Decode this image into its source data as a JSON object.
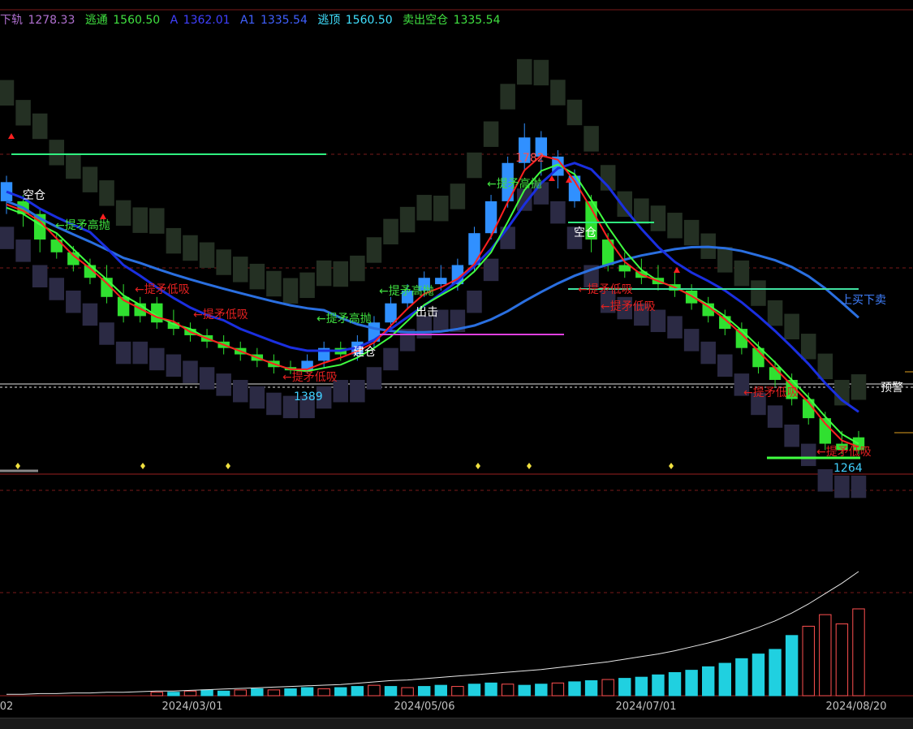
{
  "legend": {
    "lower_band_label": "下轨",
    "lower_band_value": "1278.33",
    "escape_label": "逃通",
    "escape_value": "1560.50",
    "a_label": "A",
    "a_value": "1362.01",
    "a1_label": "A1",
    "a1_value": "1335.54",
    "top_label": "逃顶",
    "top_value": "1560.50",
    "sell_label": "卖出空仓",
    "sell_value": "1335.54"
  },
  "colors": {
    "lower_band": "#b070d0",
    "escape": "#40e040",
    "a": "#4040ff",
    "a1": "#4060ff",
    "top": "#40e0ff",
    "sell": "#40e040",
    "up_bar": "#30e030",
    "down_bar": "#3090ff",
    "cloud_top": "#243023",
    "cloud_bottom": "#2b2a44",
    "ma_blue": "#2a6fe0",
    "ma_navy": "#1a2fe0",
    "ma_green": "#40ff40",
    "ma_red": "#ff2020",
    "grid": "#7a1a1a",
    "vol_cyan": "#20d0e0",
    "vol_red": "#ff5050"
  },
  "annotations": {
    "high_value": "1782",
    "low_value_1": "1389",
    "low_value_2": "1264",
    "warn_label": "预警",
    "buy_sell_label": "上买下卖",
    "short_label": "空仓",
    "build_label": "建仓",
    "out_label": "出击",
    "top_throw": "←提矛高抛",
    "low_absorb": "←提矛低吸"
  },
  "x_axis": {
    "labels": [
      "02",
      "2024/03/01",
      "2024/05/06",
      "2024/07/01",
      "2024/08/20"
    ]
  },
  "chart_data": {
    "type": "bar",
    "panes": [
      "price",
      "volume"
    ],
    "price_ylim": [
      1240,
      1950
    ],
    "dates_note_only_axis": [
      "2024/03/01",
      "2024/05/06",
      "2024/07/01",
      "2024/08/20"
    ],
    "price_bars": [
      {
        "o": 1690,
        "c": 1660,
        "h": 1700,
        "l": 1640,
        "u": 0
      },
      {
        "o": 1660,
        "c": 1640,
        "h": 1670,
        "l": 1620,
        "u": 1
      },
      {
        "o": 1640,
        "c": 1600,
        "h": 1650,
        "l": 1580,
        "u": 1
      },
      {
        "o": 1600,
        "c": 1580,
        "h": 1610,
        "l": 1570,
        "u": 1
      },
      {
        "o": 1580,
        "c": 1560,
        "h": 1590,
        "l": 1550,
        "u": 1
      },
      {
        "o": 1560,
        "c": 1540,
        "h": 1570,
        "l": 1530,
        "u": 1
      },
      {
        "o": 1540,
        "c": 1510,
        "h": 1560,
        "l": 1500,
        "u": 1
      },
      {
        "o": 1510,
        "c": 1480,
        "h": 1530,
        "l": 1470,
        "u": 1
      },
      {
        "o": 1480,
        "c": 1500,
        "h": 1510,
        "l": 1470,
        "u": 1
      },
      {
        "o": 1500,
        "c": 1470,
        "h": 1510,
        "l": 1460,
        "u": 1
      },
      {
        "o": 1470,
        "c": 1460,
        "h": 1490,
        "l": 1450,
        "u": 1
      },
      {
        "o": 1460,
        "c": 1450,
        "h": 1470,
        "l": 1440,
        "u": 1
      },
      {
        "o": 1450,
        "c": 1440,
        "h": 1460,
        "l": 1430,
        "u": 1
      },
      {
        "o": 1440,
        "c": 1430,
        "h": 1450,
        "l": 1420,
        "u": 1
      },
      {
        "o": 1430,
        "c": 1420,
        "h": 1440,
        "l": 1410,
        "u": 1
      },
      {
        "o": 1420,
        "c": 1410,
        "h": 1430,
        "l": 1400,
        "u": 1
      },
      {
        "o": 1410,
        "c": 1400,
        "h": 1420,
        "l": 1390,
        "u": 1
      },
      {
        "o": 1400,
        "c": 1395,
        "h": 1410,
        "l": 1389,
        "u": 1
      },
      {
        "o": 1395,
        "c": 1410,
        "h": 1420,
        "l": 1390,
        "u": 0
      },
      {
        "o": 1410,
        "c": 1430,
        "h": 1440,
        "l": 1400,
        "u": 0
      },
      {
        "o": 1430,
        "c": 1420,
        "h": 1440,
        "l": 1410,
        "u": 1
      },
      {
        "o": 1420,
        "c": 1440,
        "h": 1450,
        "l": 1410,
        "u": 0
      },
      {
        "o": 1440,
        "c": 1470,
        "h": 1480,
        "l": 1430,
        "u": 0
      },
      {
        "o": 1470,
        "c": 1500,
        "h": 1510,
        "l": 1460,
        "u": 0
      },
      {
        "o": 1500,
        "c": 1520,
        "h": 1530,
        "l": 1490,
        "u": 0
      },
      {
        "o": 1520,
        "c": 1540,
        "h": 1550,
        "l": 1510,
        "u": 0
      },
      {
        "o": 1540,
        "c": 1530,
        "h": 1560,
        "l": 1520,
        "u": 0
      },
      {
        "o": 1530,
        "c": 1560,
        "h": 1570,
        "l": 1520,
        "u": 0
      },
      {
        "o": 1560,
        "c": 1610,
        "h": 1620,
        "l": 1550,
        "u": 0
      },
      {
        "o": 1610,
        "c": 1660,
        "h": 1670,
        "l": 1600,
        "u": 0
      },
      {
        "o": 1660,
        "c": 1720,
        "h": 1730,
        "l": 1650,
        "u": 0
      },
      {
        "o": 1720,
        "c": 1760,
        "h": 1782,
        "l": 1710,
        "u": 0
      },
      {
        "o": 1760,
        "c": 1730,
        "h": 1770,
        "l": 1700,
        "u": 0
      },
      {
        "o": 1730,
        "c": 1700,
        "h": 1740,
        "l": 1680,
        "u": 0
      },
      {
        "o": 1700,
        "c": 1660,
        "h": 1710,
        "l": 1650,
        "u": 0
      },
      {
        "o": 1660,
        "c": 1600,
        "h": 1670,
        "l": 1580,
        "u": 1
      },
      {
        "o": 1600,
        "c": 1560,
        "h": 1610,
        "l": 1550,
        "u": 1
      },
      {
        "o": 1560,
        "c": 1550,
        "h": 1580,
        "l": 1540,
        "u": 1
      },
      {
        "o": 1550,
        "c": 1540,
        "h": 1570,
        "l": 1530,
        "u": 1
      },
      {
        "o": 1540,
        "c": 1530,
        "h": 1560,
        "l": 1520,
        "u": 1
      },
      {
        "o": 1530,
        "c": 1520,
        "h": 1550,
        "l": 1510,
        "u": 1
      },
      {
        "o": 1520,
        "c": 1500,
        "h": 1530,
        "l": 1490,
        "u": 1
      },
      {
        "o": 1500,
        "c": 1480,
        "h": 1510,
        "l": 1470,
        "u": 1
      },
      {
        "o": 1480,
        "c": 1460,
        "h": 1490,
        "l": 1450,
        "u": 1
      },
      {
        "o": 1460,
        "c": 1430,
        "h": 1470,
        "l": 1420,
        "u": 1
      },
      {
        "o": 1430,
        "c": 1400,
        "h": 1440,
        "l": 1390,
        "u": 1
      },
      {
        "o": 1400,
        "c": 1380,
        "h": 1410,
        "l": 1370,
        "u": 1
      },
      {
        "o": 1380,
        "c": 1350,
        "h": 1390,
        "l": 1340,
        "u": 1
      },
      {
        "o": 1350,
        "c": 1320,
        "h": 1360,
        "l": 1310,
        "u": 1
      },
      {
        "o": 1320,
        "c": 1280,
        "h": 1330,
        "l": 1270,
        "u": 1
      },
      {
        "o": 1280,
        "c": 1270,
        "h": 1300,
        "l": 1264,
        "u": 1
      },
      {
        "o": 1270,
        "c": 1290,
        "h": 1300,
        "l": 1264,
        "u": 1
      }
    ],
    "volume": [
      2,
      2,
      2,
      3,
      3,
      3,
      4,
      4,
      4,
      3,
      3,
      4,
      5,
      4,
      5,
      6,
      5,
      6,
      7,
      6,
      7,
      8,
      9,
      8,
      7,
      8,
      9,
      8,
      10,
      11,
      10,
      9,
      10,
      11,
      12,
      13,
      14,
      15,
      16,
      18,
      20,
      22,
      25,
      28,
      32,
      36,
      40,
      52,
      60,
      70,
      62,
      75
    ],
    "volume_colors": [
      "c",
      "r",
      "c",
      "c",
      "r",
      "c",
      "r",
      "c",
      "c",
      "r",
      "c",
      "r",
      "c",
      "c",
      "r",
      "c",
      "r",
      "c",
      "c",
      "r",
      "c",
      "c",
      "r",
      "c",
      "r",
      "c",
      "c",
      "r",
      "c",
      "c",
      "r",
      "c",
      "c",
      "r",
      "c",
      "c",
      "r",
      "c",
      "c",
      "c",
      "c",
      "c",
      "c",
      "c",
      "c",
      "c",
      "c",
      "c",
      "r",
      "r",
      "r",
      "r"
    ],
    "volume_cum_line": [
      1,
      1,
      2,
      2,
      3,
      3,
      4,
      4,
      5,
      6,
      6,
      7,
      8,
      9,
      10,
      11,
      12,
      13,
      14,
      15,
      16,
      18,
      20,
      22,
      23,
      25,
      27,
      29,
      31,
      33,
      35,
      37,
      39,
      42,
      45,
      48,
      51,
      55,
      59,
      63,
      68,
      74,
      80,
      87,
      95,
      104,
      114,
      126,
      140,
      156,
      172,
      190
    ]
  }
}
